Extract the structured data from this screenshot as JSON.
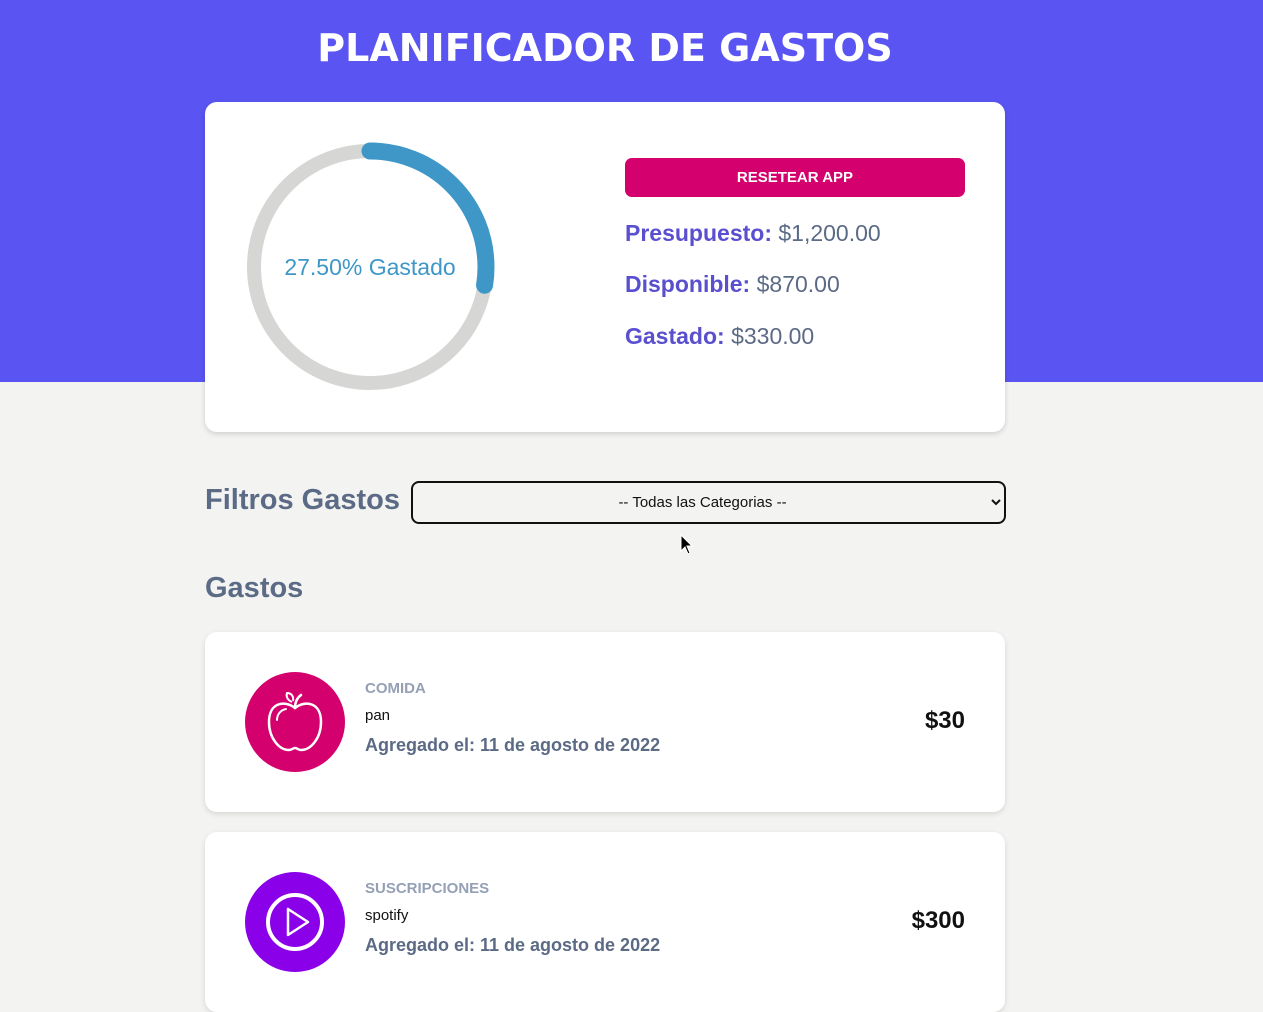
{
  "header": {
    "title": "PLANIFICADOR DE GASTOS"
  },
  "budget": {
    "spent_percent": 27.5,
    "progress_label": "27.50% Gastado",
    "reset_label": "RESETEAR APP",
    "budget_label": "Presupuesto:",
    "budget_value": "$1,200.00",
    "available_label": "Disponible:",
    "available_value": "$870.00",
    "spent_label": "Gastado:",
    "spent_value": "$330.00",
    "colors": {
      "progress": "#3e97c6",
      "track": "#d6d6d4",
      "button": "#d3006d"
    }
  },
  "filters": {
    "label": "Filtros Gastos",
    "selected": "-- Todas las Categorias --"
  },
  "expenses": {
    "title": "Gastos",
    "items": [
      {
        "category": "COMIDA",
        "name": "pan",
        "date": "Agregado el: 11 de agosto de 2022",
        "amount": "$30",
        "icon": "apple-icon",
        "color": "#d3006d"
      },
      {
        "category": "SUSCRIPCIONES",
        "name": "spotify",
        "date": "Agregado el: 11 de agosto de 2022",
        "amount": "$300",
        "icon": "play-icon",
        "color": "#8a00e8"
      }
    ]
  },
  "theme": {
    "primary": "#5a55f2",
    "background": "#f3f4f2"
  }
}
